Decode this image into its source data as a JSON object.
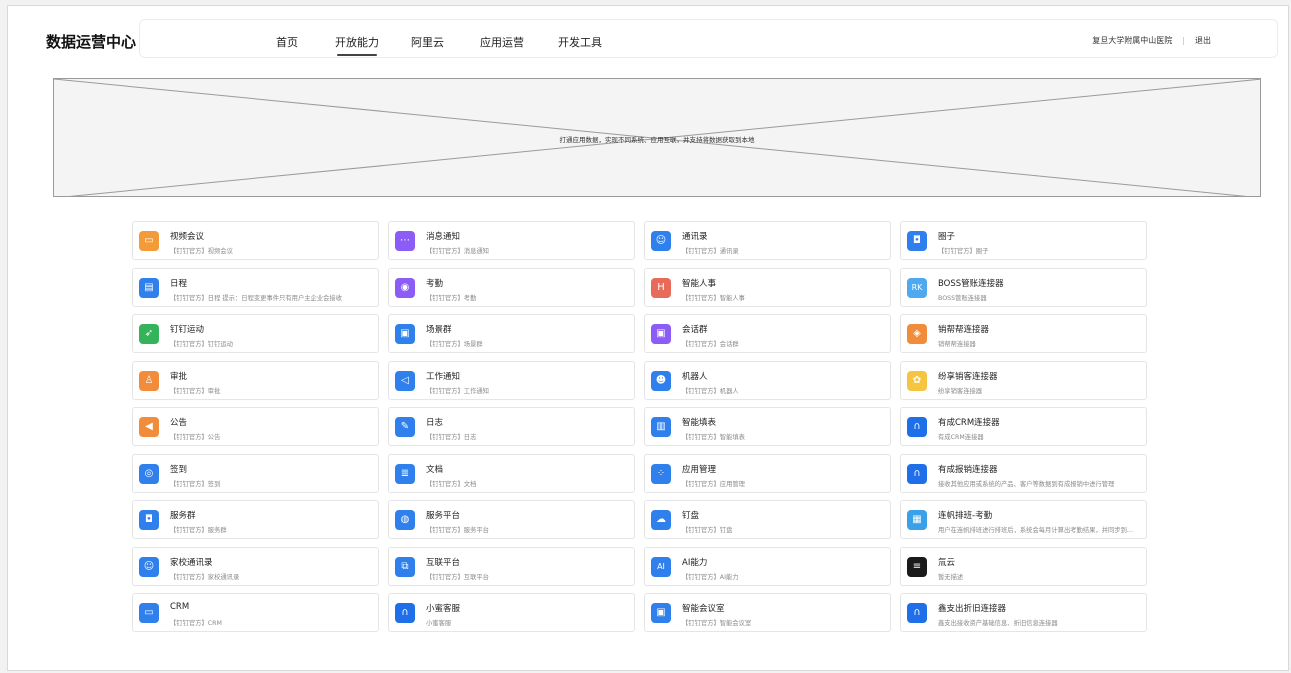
{
  "app_title": "数据运营中心",
  "nav": [
    {
      "label": "首页"
    },
    {
      "label": "开放能力"
    },
    {
      "label": "阿里云"
    },
    {
      "label": "应用运营"
    },
    {
      "label": "开发工具"
    }
  ],
  "nav_active": "开放能力",
  "user": {
    "org": "复旦大学附属中山医院",
    "separator": "|",
    "logout": "退出"
  },
  "banner": {
    "text": "打通应用数据，实现不同系统、应用互联，并支持将数据获取到本地"
  },
  "colors": {
    "blue": "#2f80ed",
    "purple": "#8b5cf6",
    "orange": "#f08c3a",
    "green": "#34b35a",
    "red": "#e86b5a",
    "sky": "#4ea9f0"
  },
  "cards": [
    {
      "title": "视频会议",
      "sub": "【钉钉官方】视频会议",
      "icon": "video-icon",
      "glyph": "▭",
      "color": "#f29b38"
    },
    {
      "title": "消息通知",
      "sub": "【钉钉官方】消息通知",
      "icon": "message-icon",
      "glyph": "⋯",
      "color": "#8b5cf6"
    },
    {
      "title": "通讯录",
      "sub": "【钉钉官方】通讯录",
      "icon": "contacts-icon",
      "glyph": "☺",
      "color": "#2f80ed"
    },
    {
      "title": "圈子",
      "sub": "【钉钉官方】圈子",
      "icon": "bookmark-icon",
      "glyph": "◘",
      "color": "#2f80ed"
    },
    {
      "title": "日程",
      "sub": "【钉钉官方】日程 提示：日程变更事件只有用户主企业会接收",
      "icon": "calendar-icon",
      "glyph": "▤",
      "color": "#2f80ed"
    },
    {
      "title": "考勤",
      "sub": "【钉钉官方】考勤",
      "icon": "location-icon",
      "glyph": "◉",
      "color": "#8b5cf6"
    },
    {
      "title": "智能人事",
      "sub": "【钉钉官方】智能人事",
      "icon": "hr-icon",
      "glyph": "H",
      "color": "#e86b5a"
    },
    {
      "title": "BOSS管账连接器",
      "sub": "BOSS管账连接器",
      "icon": "boss-icon",
      "glyph": "RK",
      "color": "#4ea9f0"
    },
    {
      "title": "钉钉运动",
      "sub": "【钉钉官方】钉钉运动",
      "icon": "running-icon",
      "glyph": "➶",
      "color": "#34b35a"
    },
    {
      "title": "场景群",
      "sub": "【钉钉官方】场景群",
      "icon": "scene-group-icon",
      "glyph": "▣",
      "color": "#2f80ed"
    },
    {
      "title": "会话群",
      "sub": "【钉钉官方】会话群",
      "icon": "chat-group-icon",
      "glyph": "▣",
      "color": "#8b5cf6"
    },
    {
      "title": "销帮帮连接器",
      "sub": "销帮帮连接器",
      "icon": "xbb-logo-icon",
      "glyph": "◈",
      "color": "#f08c3a"
    },
    {
      "title": "审批",
      "sub": "【钉钉官方】审批",
      "icon": "stamp-icon",
      "glyph": "♙",
      "color": "#f08c3a"
    },
    {
      "title": "工作通知",
      "sub": "【钉钉官方】工作通知",
      "icon": "speaker-icon",
      "glyph": "◁",
      "color": "#2f80ed"
    },
    {
      "title": "机器人",
      "sub": "【钉钉官方】机器人",
      "icon": "robot-icon",
      "glyph": "☻",
      "color": "#2f80ed"
    },
    {
      "title": "纷享销客连接器",
      "sub": "纷享销客连接器",
      "icon": "fxiaoke-logo-icon",
      "glyph": "✿",
      "color": "#f5c542"
    },
    {
      "title": "公告",
      "sub": "【钉钉官方】公告",
      "icon": "megaphone-icon",
      "glyph": "◀",
      "color": "#f08c3a"
    },
    {
      "title": "日志",
      "sub": "【钉钉官方】日志",
      "icon": "log-icon",
      "glyph": "✎",
      "color": "#2f80ed"
    },
    {
      "title": "智能填表",
      "sub": "【钉钉官方】智能填表",
      "icon": "chart-icon",
      "glyph": "▥",
      "color": "#2f80ed"
    },
    {
      "title": "有成CRM连接器",
      "sub": "有成CRM连接器",
      "icon": "headset-icon",
      "glyph": "∩",
      "color": "#1f6fe8"
    },
    {
      "title": "签到",
      "sub": "【钉钉官方】签到",
      "icon": "checkin-icon",
      "glyph": "◎",
      "color": "#2f80ed"
    },
    {
      "title": "文档",
      "sub": "【钉钉官方】文档",
      "icon": "document-icon",
      "glyph": "≣",
      "color": "#2f80ed"
    },
    {
      "title": "应用管理",
      "sub": "【钉钉官方】应用管理",
      "icon": "apps-icon",
      "glyph": "⁘",
      "color": "#2f80ed"
    },
    {
      "title": "有成报销连接器",
      "sub": "接收其他应用或系统的产品、客户等数据到有成报销中进行管理",
      "icon": "headset-icon",
      "glyph": "∩",
      "color": "#1f6fe8"
    },
    {
      "title": "服务群",
      "sub": "【钉钉官方】服务群",
      "icon": "service-group-icon",
      "glyph": "◘",
      "color": "#2f80ed"
    },
    {
      "title": "服务平台",
      "sub": "【钉钉官方】服务平台",
      "icon": "service-platform-icon",
      "glyph": "◍",
      "color": "#2f80ed"
    },
    {
      "title": "钉盘",
      "sub": "【钉钉官方】钉盘",
      "icon": "cloud-drive-icon",
      "glyph": "☁",
      "color": "#2f80ed"
    },
    {
      "title": "连帆排班-考勤",
      "sub": "用户在连帆排班进行排班后，系统会每月计算出考勤结果，并同步到钉钉",
      "icon": "schedule-icon",
      "glyph": "▦",
      "color": "#3aa0e8"
    },
    {
      "title": "家校通讯录",
      "sub": "【钉钉官方】家校通讯录",
      "icon": "school-contacts-icon",
      "glyph": "☺",
      "color": "#2f80ed"
    },
    {
      "title": "互联平台",
      "sub": "【钉钉官方】互联平台",
      "icon": "link-platform-icon",
      "glyph": "⧉",
      "color": "#2f80ed"
    },
    {
      "title": "AI能力",
      "sub": "【钉钉官方】AI能力",
      "icon": "ai-icon",
      "glyph": "AI",
      "color": "#2f80ed"
    },
    {
      "title": "氚云",
      "sub": "暂无描述",
      "icon": "chuanyun-logo-icon",
      "glyph": "≡",
      "color": "#1a1a1a"
    },
    {
      "title": "CRM",
      "sub": "【钉钉官方】CRM",
      "icon": "folder-icon",
      "glyph": "▭",
      "color": "#2f80ed"
    },
    {
      "title": "小蜜客服",
      "sub": "小蜜客服",
      "icon": "headset-icon",
      "glyph": "∩",
      "color": "#1f6fe8"
    },
    {
      "title": "智能会议室",
      "sub": "【钉钉官方】智能会议室",
      "icon": "meeting-room-icon",
      "glyph": "▣",
      "color": "#2f80ed"
    },
    {
      "title": "鑫支出折旧连接器",
      "sub": "鑫支出接收资产基础信息、折旧信息连接器",
      "icon": "headset-icon",
      "glyph": "∩",
      "color": "#1f6fe8"
    }
  ]
}
